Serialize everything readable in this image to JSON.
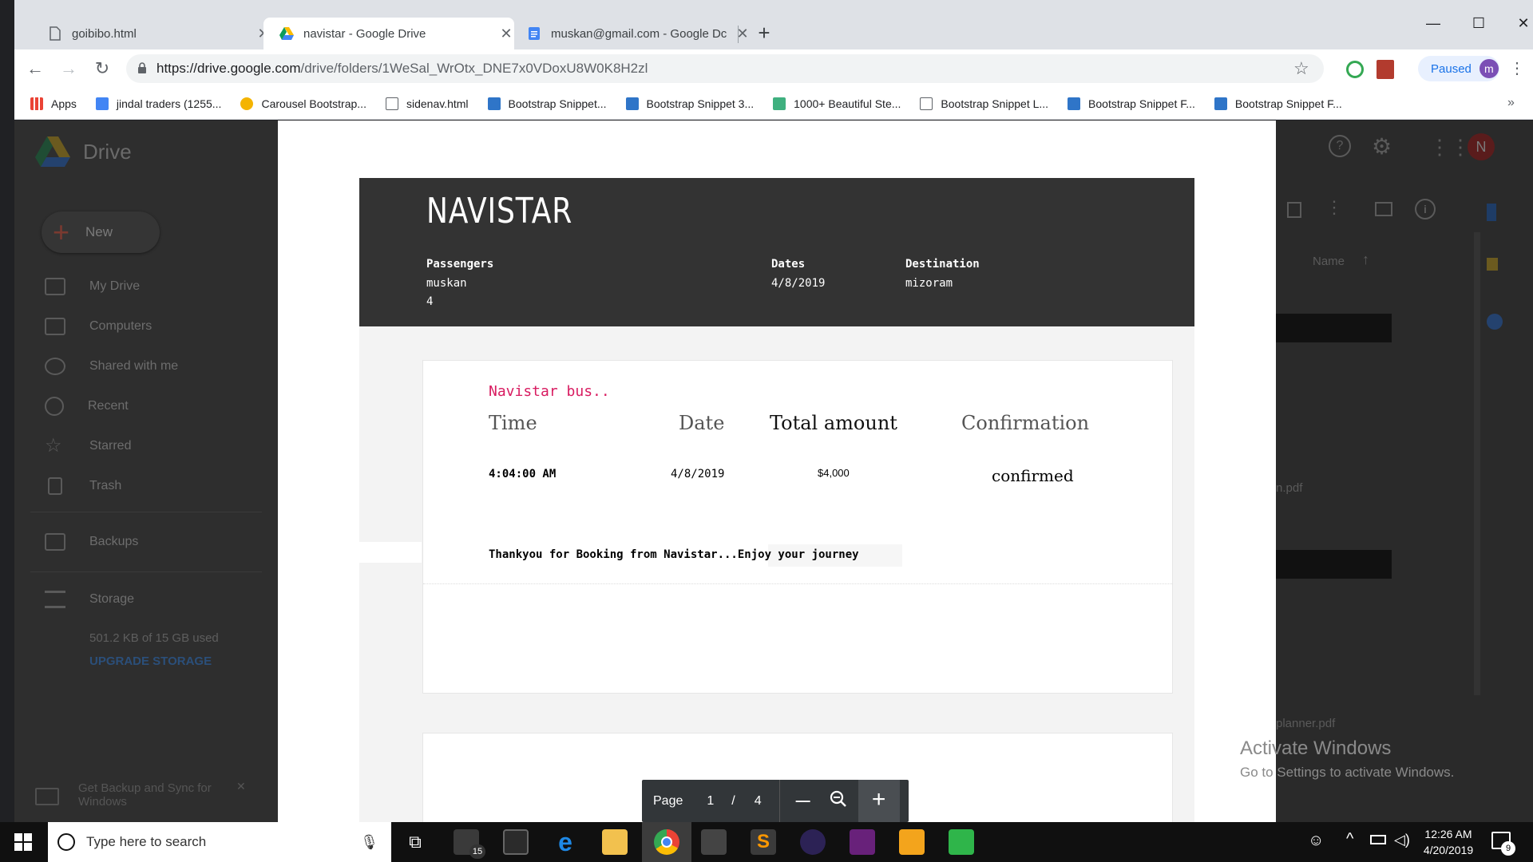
{
  "browser": {
    "tabs": [
      {
        "title": "goibibo.html",
        "active": false
      },
      {
        "title": "navistar - Google Drive",
        "active": true
      },
      {
        "title": "muskan@gmail.com - Google Dc",
        "active": false
      }
    ],
    "new_tab": "+",
    "url_host": "https://drive.google.com",
    "url_path": "/drive/folders/1WeSal_WrOtx_DNE7x0VDoxU8W0K8H2zl",
    "profile_label": "Paused",
    "profile_initial": "m",
    "bookmarks": [
      "Apps",
      "jindal traders (1255...",
      "Carousel Bootstrap...",
      "sidenav.html",
      "Bootstrap Snippet...",
      "Bootstrap Snippet 3...",
      "1000+ Beautiful Ste...",
      "Bootstrap Snippet L...",
      "Bootstrap Snippet F...",
      "Bootstrap Snippet F..."
    ],
    "more_bookmarks": "»"
  },
  "drive": {
    "logo": "Drive",
    "new_label": "New",
    "nav": [
      "My Drive",
      "Computers",
      "Shared with me",
      "Recent",
      "Starred",
      "Trash",
      "Backups",
      "Storage"
    ],
    "storage_used": "501.2 KB of 15 GB used",
    "upgrade": "UPGRADE STORAGE",
    "backup_promo": "Get Backup and Sync for Windows",
    "sort_label": "Name",
    "avatar": "N",
    "file1": "n.pdf",
    "file2": "planner.pdf"
  },
  "document": {
    "brand": "NAVISTAR",
    "passengers_label": "Passengers",
    "passenger_name": "muskan",
    "passenger_count": "4",
    "dates_label": "Dates",
    "dates_value": "4/8/2019",
    "destination_label": "Destination",
    "destination_value": "mizoram",
    "bus_title": "Navistar bus..",
    "col_time": "Time",
    "col_date": "Date",
    "col_total": "Total amount",
    "col_confirm": "Confirmation",
    "time_value": "4:04:00 AM",
    "date_value": "4/8/2019",
    "total_value": "$4,000",
    "confirm_value": "confirmed",
    "thanks": "Thankyou for Booking from Navistar...Enjoy your journey"
  },
  "page_control": {
    "page_label": "Page",
    "current": "1",
    "separator": "/",
    "total": "4",
    "zoom_out": "—",
    "zoom_in": "+"
  },
  "watermark": {
    "title": "Activate Windows",
    "subtitle": "Go to Settings to activate Windows."
  },
  "taskbar": {
    "search_placeholder": "Type here to search",
    "mail_badge": "15",
    "time": "12:26 AM",
    "date": "4/20/2019",
    "notif_count": "9"
  }
}
